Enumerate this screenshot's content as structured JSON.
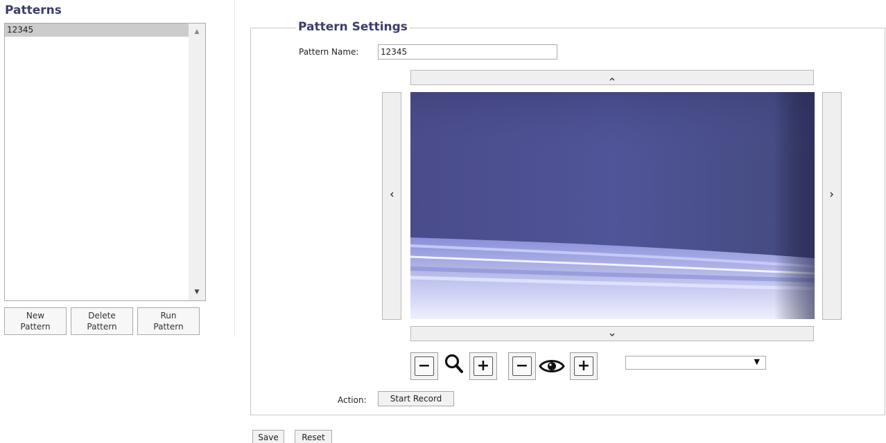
{
  "sidebar": {
    "title": "Patterns",
    "items": [
      {
        "label": "12345",
        "selected": true
      }
    ],
    "buttons": {
      "new": [
        "New",
        "Pattern"
      ],
      "delete": [
        "Delete",
        "Pattern"
      ],
      "run": [
        "Run",
        "Pattern"
      ]
    }
  },
  "settings": {
    "legend": "Pattern Settings",
    "name_label": "Pattern Name:",
    "name_value": "12345",
    "pan": {
      "up": "^",
      "down": "v",
      "left": "<",
      "right": ">"
    },
    "controls": {
      "zoom_out": "−",
      "zoom_icon": "magnifier-icon",
      "zoom_in": "+",
      "focus_out": "−",
      "focus_icon": "eye-icon",
      "focus_in": "+"
    },
    "preset_select": {
      "value": ""
    },
    "action_label": "Action:",
    "start_record": "Start Record"
  },
  "footer": {
    "save": "Save",
    "reset": "Reset"
  },
  "colors": {
    "title": "#3b3d6b",
    "selected_item": "#cccccc",
    "video_tint": "#4e4f8f"
  }
}
